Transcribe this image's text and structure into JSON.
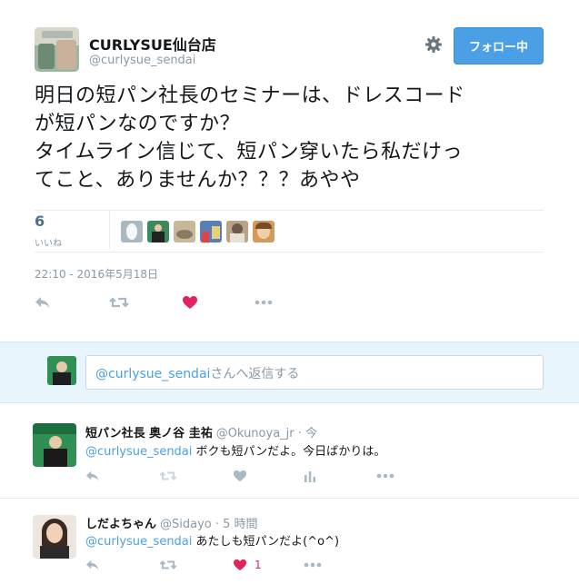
{
  "tweet": {
    "display_name": "CURLYSUE仙台店",
    "handle": "@curlysue_sendai",
    "follow_label": "フォロー中",
    "text_lines": [
      "明日の短パン社長のセミナーは、ドレスコード",
      "が短パンなのですか？",
      "タイムライン信じて、短パン穿いたら私だけっ",
      "てこと、ありませんか？？？あやや"
    ],
    "likes_count": "6",
    "likes_label": "いいね",
    "timestamp": "22:10 - 2016年5月18日"
  },
  "reply_box": {
    "mention": "@curlysue_sendai",
    "placeholder_suffix": "さんへ返信する"
  },
  "replies": [
    {
      "name": "短パン社長 奥ノ谷 圭祐",
      "handle": "@Okunoya_jr · 今",
      "mention": "@curlysue_sendai",
      "text": " ボクも短パンだよ。今日ばかりは。",
      "like_count": ""
    },
    {
      "name": "しだよちゃん",
      "handle": "@Sidayo · 5 時間",
      "mention": "@curlysue_sendai",
      "text": " あたしも短パンだよ(^o^)",
      "like_count": "1"
    }
  ],
  "colors": {
    "accent": "#4ba0e5",
    "like_red": "#e0245e",
    "icon_gray": "#aab8c2"
  },
  "icons": [
    "gear-icon",
    "reply-icon",
    "retweet-icon",
    "heart-icon",
    "more-icon",
    "analytics-icon"
  ]
}
